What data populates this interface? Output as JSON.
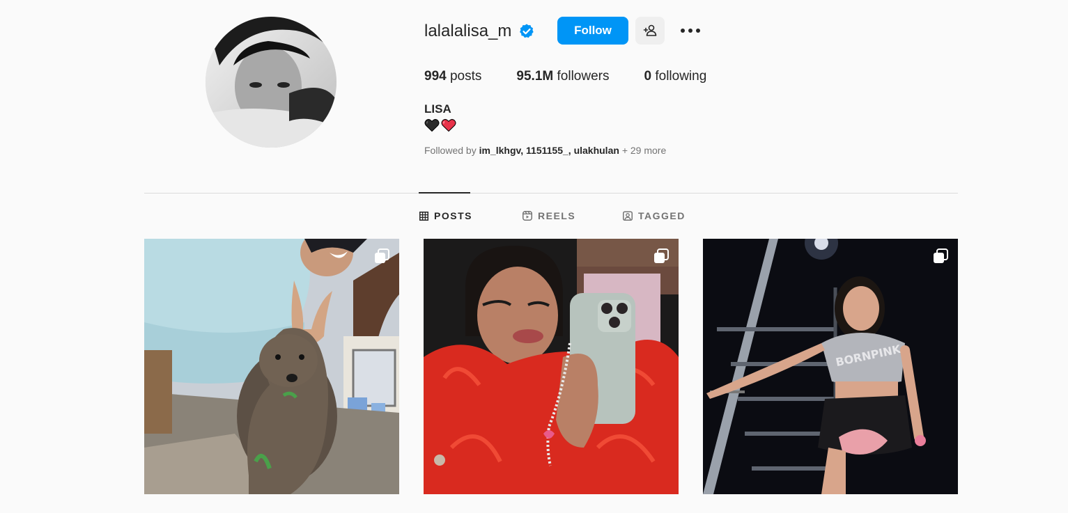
{
  "profile": {
    "username": "lalalalisa_m",
    "verified": true,
    "follow_label": "Follow",
    "stats": {
      "posts_count": "994",
      "posts_label": "posts",
      "followers_count": "95.1M",
      "followers_label": "followers",
      "following_count": "0",
      "following_label": "following"
    },
    "full_name": "LISA",
    "bio_emoji": [
      "black-heart",
      "red-heart"
    ],
    "followed_by": {
      "prefix": "Followed by",
      "users": [
        "im_lkhgv",
        "1151155_",
        "ulakhulan"
      ],
      "more": "+ 29 more"
    }
  },
  "tabs": [
    {
      "label": "POSTS",
      "icon": "grid-icon",
      "active": true
    },
    {
      "label": "REELS",
      "icon": "reels-icon",
      "active": false
    },
    {
      "label": "TAGGED",
      "icon": "tagged-icon",
      "active": false
    }
  ],
  "posts": [
    {
      "multi": true,
      "subject": "selfie-with-quokka"
    },
    {
      "multi": true,
      "subject": "mirror-selfie-red-feathers"
    },
    {
      "multi": true,
      "subject": "stage-stairs-pose"
    }
  ],
  "colors": {
    "accent": "#0095f6",
    "verified": "#0095f6",
    "text": "#262626",
    "muted": "#737373",
    "background": "#fafafa"
  }
}
